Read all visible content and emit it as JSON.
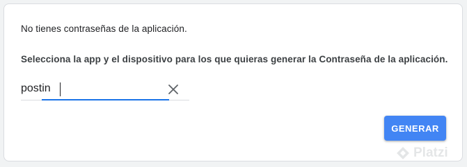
{
  "passwords": {
    "empty_message": "No tienes contraseñas de la aplicación.",
    "instructions": "Selecciona la app y el dispositivo para los que quieras generar la Contraseña de la aplicación.",
    "app_input": {
      "value": "postin",
      "clear_icon": "close-icon"
    },
    "generate_label": "GENERAR"
  },
  "watermark": {
    "text": "Platzi"
  },
  "colors": {
    "accent": "#4285f4",
    "focus": "#1a73e8"
  }
}
